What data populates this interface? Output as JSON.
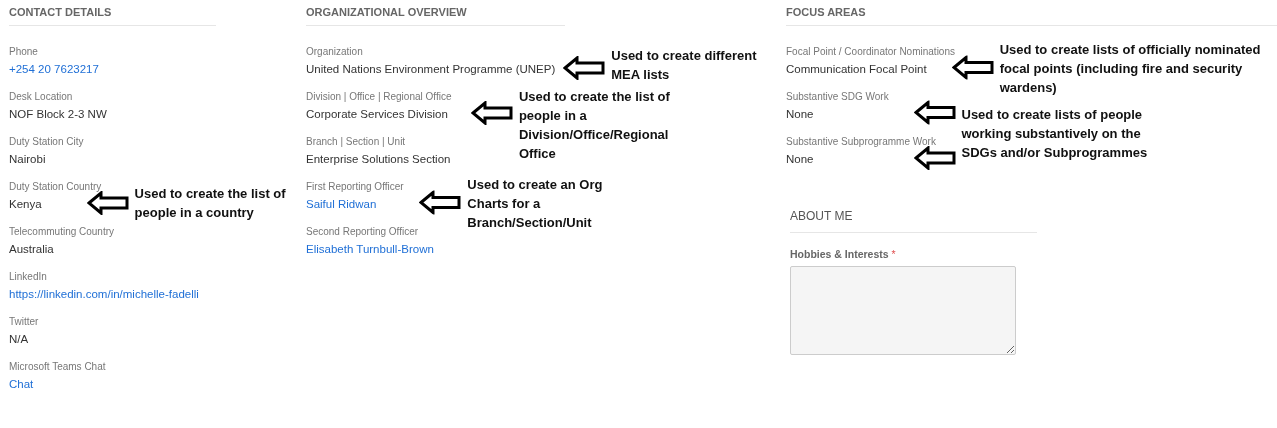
{
  "sections": [
    {
      "title": "CONTACT DETAILS",
      "fields": [
        {
          "label": "Phone",
          "value": "+254 20 7623217",
          "kind": "link"
        },
        {
          "label": "Desk Location",
          "value": "NOF Block 2-3 NW",
          "kind": "text"
        },
        {
          "label": "Duty Station City",
          "value": "Nairobi",
          "kind": "text"
        },
        {
          "label": "Duty Station Country",
          "value": "Kenya",
          "kind": "text",
          "arrow": true,
          "note": "Used to create the list of people in a country"
        },
        {
          "label": "Telecommuting Country",
          "value": "Australia",
          "kind": "text"
        },
        {
          "label": "LinkedIn",
          "value": "https://linkedin.com/in/michelle-fadelli",
          "kind": "link"
        },
        {
          "label": "Twitter",
          "value": "N/A",
          "kind": "text"
        },
        {
          "label": "Microsoft Teams Chat",
          "value": "Chat",
          "kind": "link"
        }
      ]
    },
    {
      "title": "ORGANIZATIONAL OVERVIEW",
      "fields": [
        {
          "label": "Organization",
          "value": "United Nations Environment Programme (UNEP)",
          "kind": "text",
          "arrow": true,
          "note": "Used to create different MEA lists"
        },
        {
          "label": "Division | Office | Regional Office",
          "value": "Corporate Services Division",
          "kind": "text",
          "arrow": true,
          "note": "Used to create the list of people in a Division/Office/Regional Office"
        },
        {
          "label": "Branch | Section | Unit",
          "value": "Enterprise Solutions Section",
          "kind": "text"
        },
        {
          "label": "First Reporting Officer",
          "value": "Saiful Ridwan",
          "kind": "link",
          "arrow": true,
          "note": "Used to create an Org Charts for a Branch/Section/Unit"
        },
        {
          "label": "Second Reporting Officer",
          "value": "Elisabeth Turnbull-Brown",
          "kind": "link"
        }
      ]
    },
    {
      "title": "FOCUS AREAS",
      "fields": [
        {
          "label": "Focal Point / Coordinator Nominations",
          "value": "Communication Focal Point",
          "kind": "text",
          "arrow": true,
          "note": "Used to create lists of officially nominated focal points (including fire and security wardens)"
        },
        {
          "label": "Substantive SDG Work",
          "value": "None",
          "kind": "text",
          "arrow": true,
          "note": "Used to create lists of people working substantively on the SDGs and/or Subprogrammes"
        },
        {
          "label": "Substantive Subprogramme Work",
          "value": "None",
          "kind": "text",
          "arrow": true
        }
      ]
    }
  ],
  "about_me": {
    "title": "ABOUT ME",
    "field_label": "Hobbies & Interests",
    "required_mark": "*"
  }
}
